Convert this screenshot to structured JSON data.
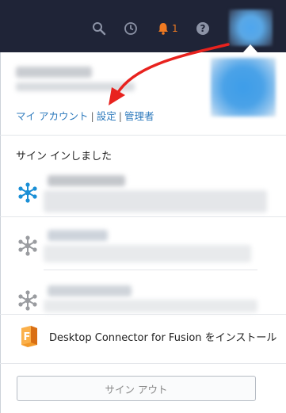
{
  "topbar": {
    "notification_count": "1",
    "icons": [
      "search-icon",
      "clock-icon",
      "bell-icon",
      "help-icon",
      "avatar"
    ]
  },
  "account": {
    "links": {
      "my_account": "マイ アカウント",
      "settings": "設定",
      "admin": "管理者",
      "separator": "|"
    }
  },
  "signed_in_label": "サイン インしました",
  "hubs": [
    {
      "icon": "hub-icon",
      "active": true,
      "color": "#1a8fd6"
    },
    {
      "icon": "hub-icon",
      "active": false,
      "color": "#9a9ca0"
    },
    {
      "icon": "hub-icon",
      "active": false,
      "color": "#9a9ca0"
    }
  ],
  "install": {
    "label": "Desktop Connector for Fusion をインストール",
    "icon": "fusion-icon"
  },
  "signout_label": "サイン アウト",
  "colors": {
    "topbar_bg": "#1f2437",
    "link": "#2f7bbd",
    "notification": "#f07a22",
    "annotation_arrow": "#e8221e"
  }
}
